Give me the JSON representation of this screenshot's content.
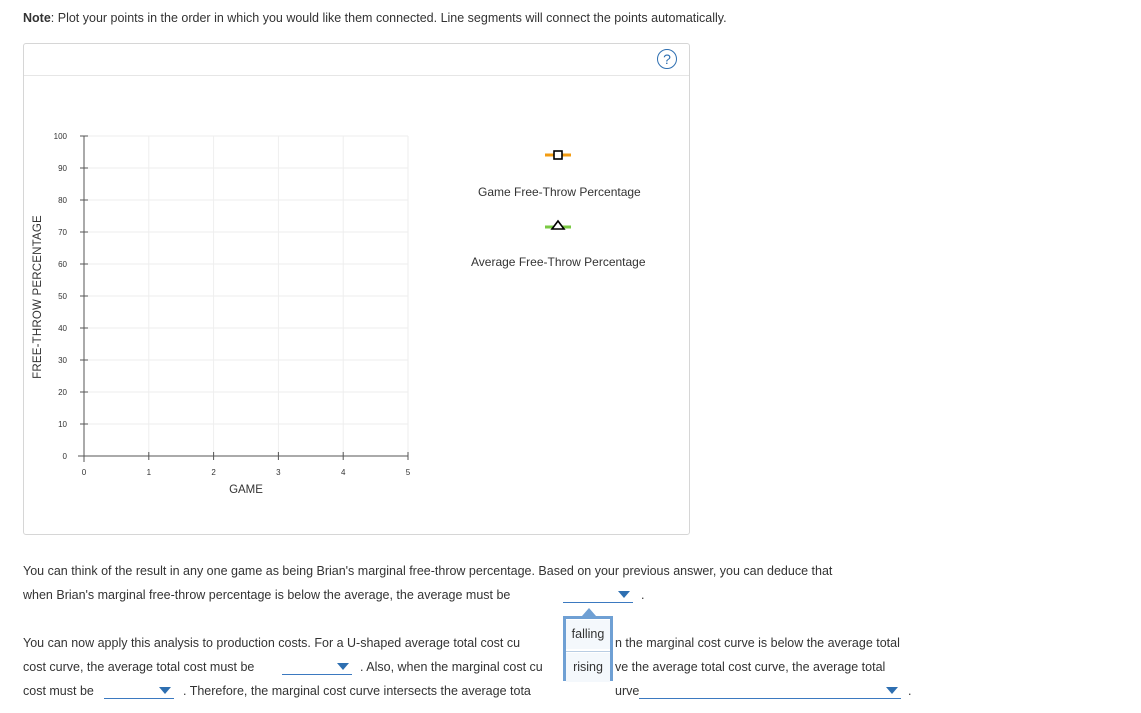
{
  "note": {
    "bold": "Note",
    "text": ": Plot your points in the order in which you would like them connected. Line segments will connect the points automatically."
  },
  "help_label": "?",
  "chart_data": {
    "type": "line",
    "xlabel": "GAME",
    "ylabel": "FREE-THROW PERCENTAGE",
    "xlim": [
      0,
      5
    ],
    "ylim": [
      0,
      100
    ],
    "x_ticks": [
      "0",
      "1",
      "2",
      "3",
      "4",
      "5"
    ],
    "y_ticks": [
      "0",
      "10",
      "20",
      "30",
      "40",
      "50",
      "60",
      "70",
      "80",
      "90",
      "100"
    ],
    "grid": true,
    "legend_position": "right",
    "series": [
      {
        "name": "Game Free-Throw Percentage",
        "marker": "square",
        "color": "#f39c12",
        "values": []
      },
      {
        "name": "Average Free-Throw Percentage",
        "marker": "triangle",
        "color": "#7ac943",
        "values": []
      }
    ]
  },
  "paragraph1": {
    "line1": "You can think of the result in any one game as being Brian's marginal free-throw percentage. Based on your previous answer, you can deduce that",
    "line2": "when Brian's marginal free-throw percentage is below the average, the average must be",
    "end": "."
  },
  "paragraph2": {
    "line1a": "You can now apply this analysis to production costs. For a U-shaped average total cost cu",
    "line1b": "n the marginal cost curve is below the average total",
    "line2a": "cost curve, the average total cost must be",
    "line2b": ". Also, when the marginal cost cu",
    "line2c": "ve the average total cost curve, the average total",
    "line3a": "cost must be",
    "line3b": ". Therefore, the marginal cost curve intersects the average tota",
    "line3c": "urve",
    "line3d": "."
  },
  "dropdown_options": [
    "falling",
    "rising"
  ]
}
